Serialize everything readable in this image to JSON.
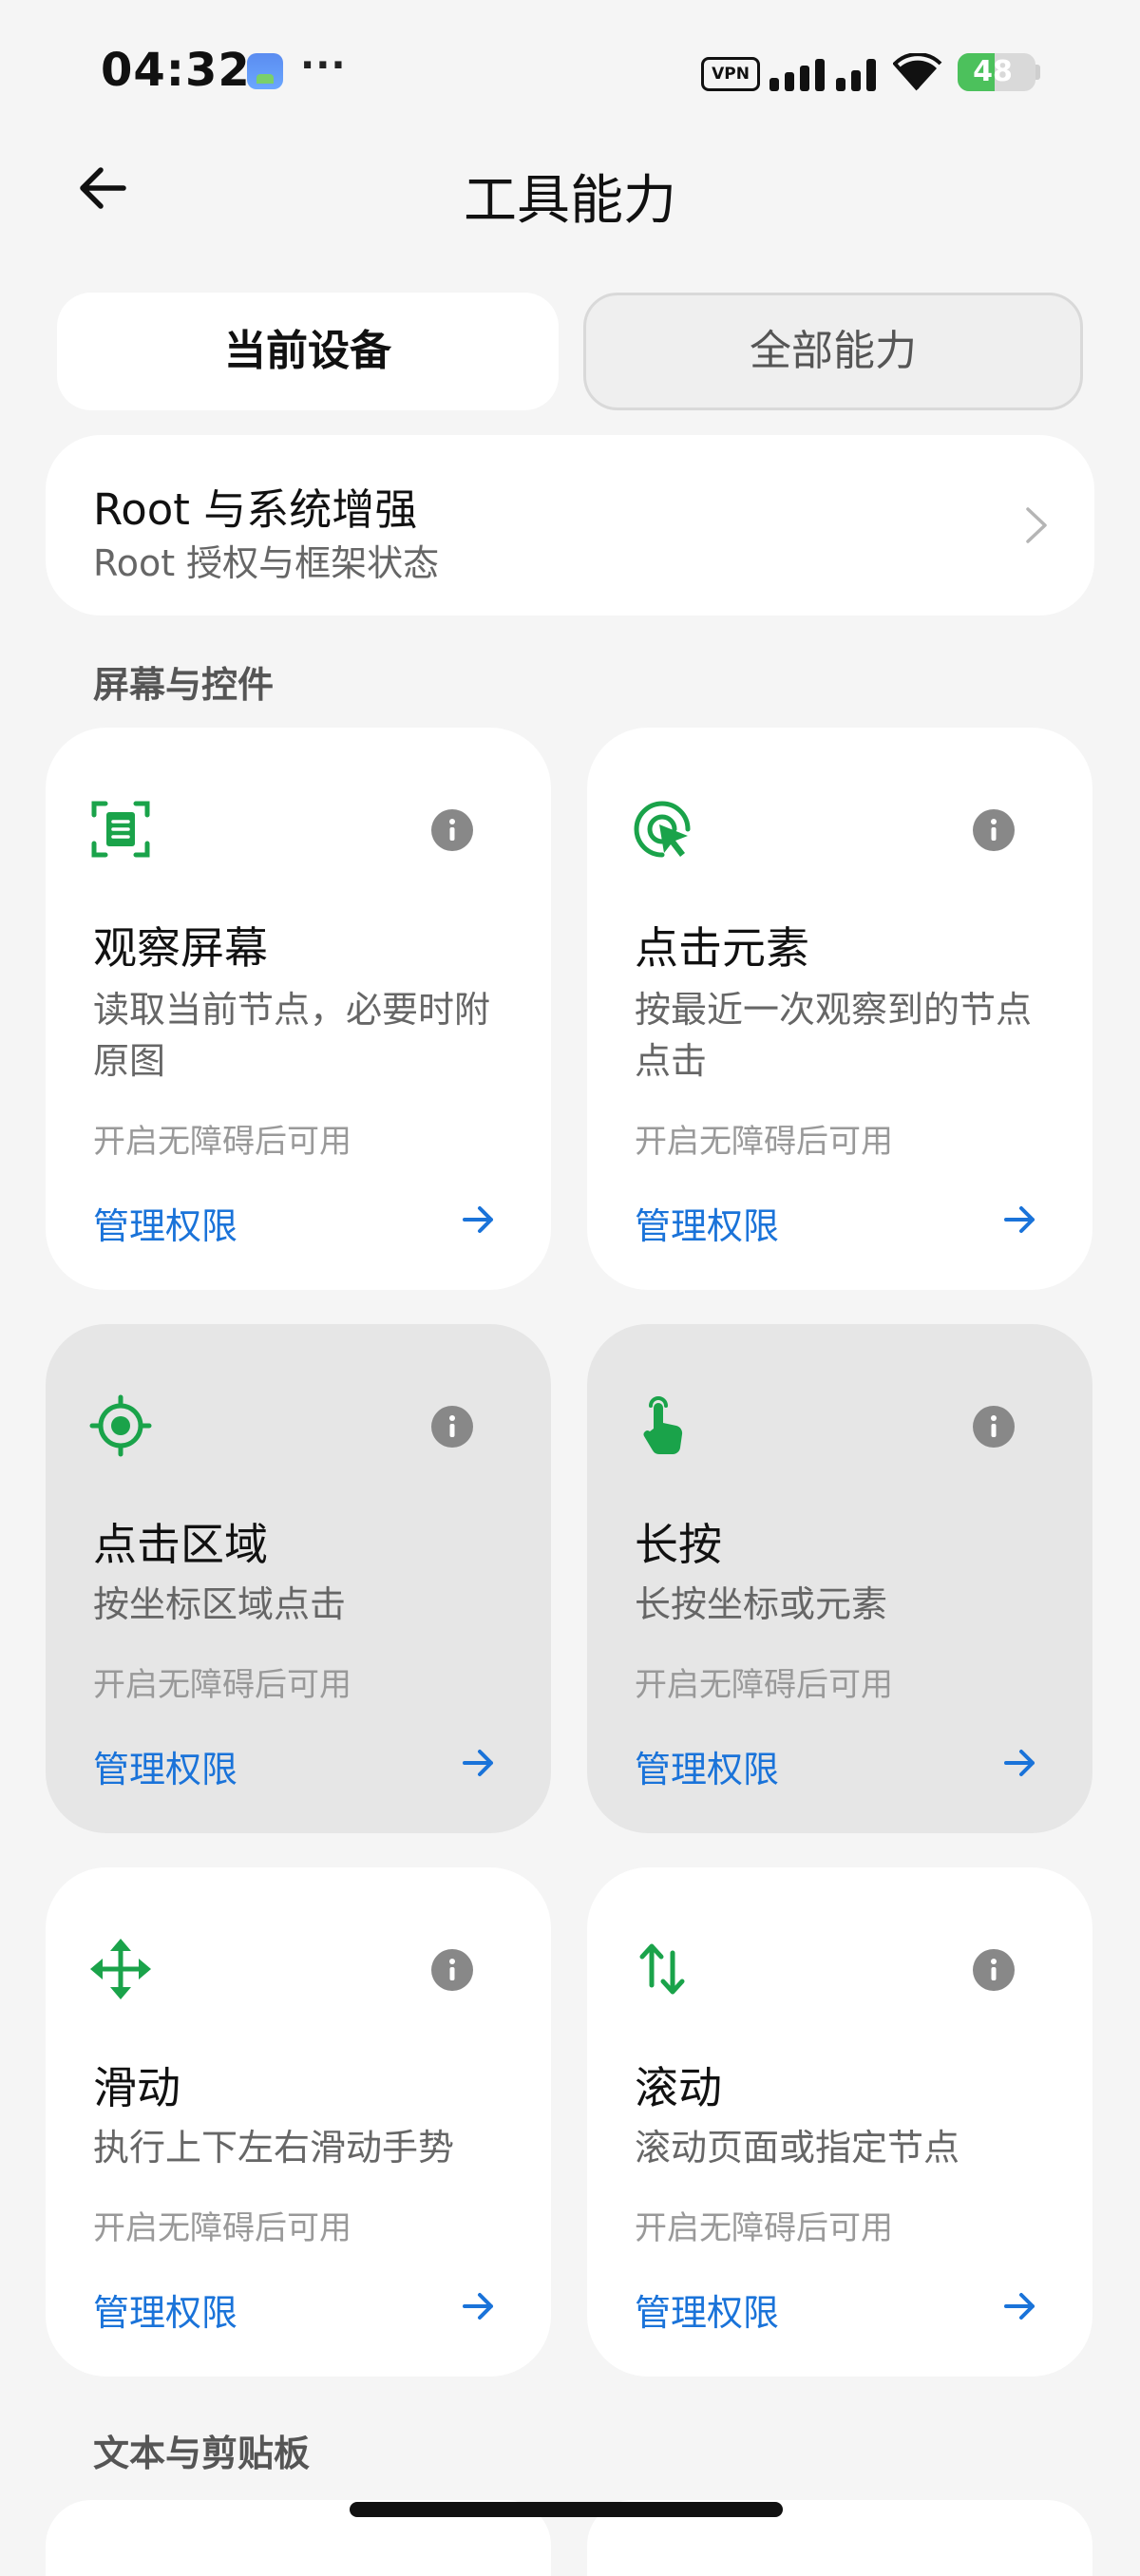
{
  "status_bar": {
    "time": "04:32",
    "notification_icon": "app-notification-icon",
    "more": "···",
    "vpn": "VPN",
    "battery": "48",
    "battery_level": 0.48,
    "battery_color": "#4cc15c"
  },
  "header": {
    "back_icon": "arrow-left-icon",
    "title": "工具能力"
  },
  "tabs": [
    {
      "label": "当前设备",
      "selected": true
    },
    {
      "label": "全部能力",
      "selected": false
    }
  ],
  "root_card": {
    "title": "Root 与系统增强",
    "subtitle": "Root 授权与框架状态"
  },
  "sections": [
    {
      "title": "屏幕与控件"
    },
    {
      "title": "文本与剪贴板"
    }
  ],
  "capabilities": [
    {
      "icon": "screen-scan-icon",
      "title": "观察屏幕",
      "desc": "读取当前节点，必要时附原图",
      "status": "开启无障碍后可用",
      "link": "管理权限"
    },
    {
      "icon": "click-cursor-icon",
      "title": "点击元素",
      "desc": "按最近一次观察到的节点点击",
      "status": "开启无障碍后可用",
      "link": "管理权限"
    },
    {
      "icon": "crosshair-target-icon",
      "title": "点击区域",
      "desc": "按坐标区域点击",
      "status": "开启无障碍后可用",
      "link": "管理权限"
    },
    {
      "icon": "touch-hand-icon",
      "title": "长按",
      "desc": "长按坐标或元素",
      "status": "开启无障碍后可用",
      "link": "管理权限"
    },
    {
      "icon": "move-arrows-icon",
      "title": "滑动",
      "desc": "执行上下左右滑动手势",
      "status": "开启无障碍后可用",
      "link": "管理权限"
    },
    {
      "icon": "swap-vertical-icon",
      "title": "滚动",
      "desc": "滚动页面或指定节点",
      "status": "开启无障碍后可用",
      "link": "管理权限"
    }
  ],
  "colors": {
    "accent_green": "#1aa34a",
    "link_blue": "#1a73d9"
  }
}
